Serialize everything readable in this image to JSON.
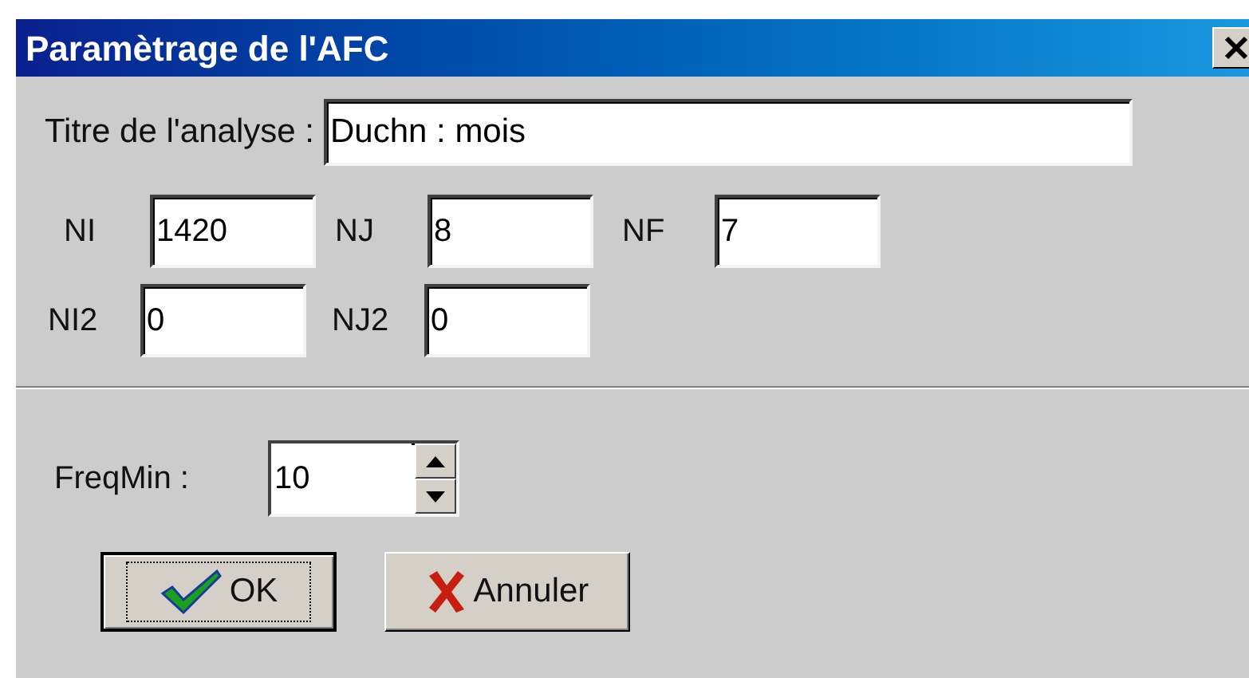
{
  "window": {
    "title": "Paramètrage de l'AFC"
  },
  "title_field": {
    "label": "Titre de l'analyse :",
    "value": "Duchn : mois"
  },
  "field_rows": [
    [
      {
        "label": "NI",
        "value": "1420"
      },
      {
        "label": "NJ",
        "value": "8"
      },
      {
        "label": "NF",
        "value": "7"
      }
    ],
    [
      {
        "label": "NI2",
        "value": "0"
      },
      {
        "label": "NJ2",
        "value": "0"
      }
    ]
  ],
  "freq_min": {
    "label": "FreqMin :",
    "value": "10"
  },
  "buttons": [
    {
      "kind": "ok",
      "label": "OK",
      "focused": true
    },
    {
      "kind": "cancel",
      "label": "Annuler",
      "focused": false
    }
  ]
}
